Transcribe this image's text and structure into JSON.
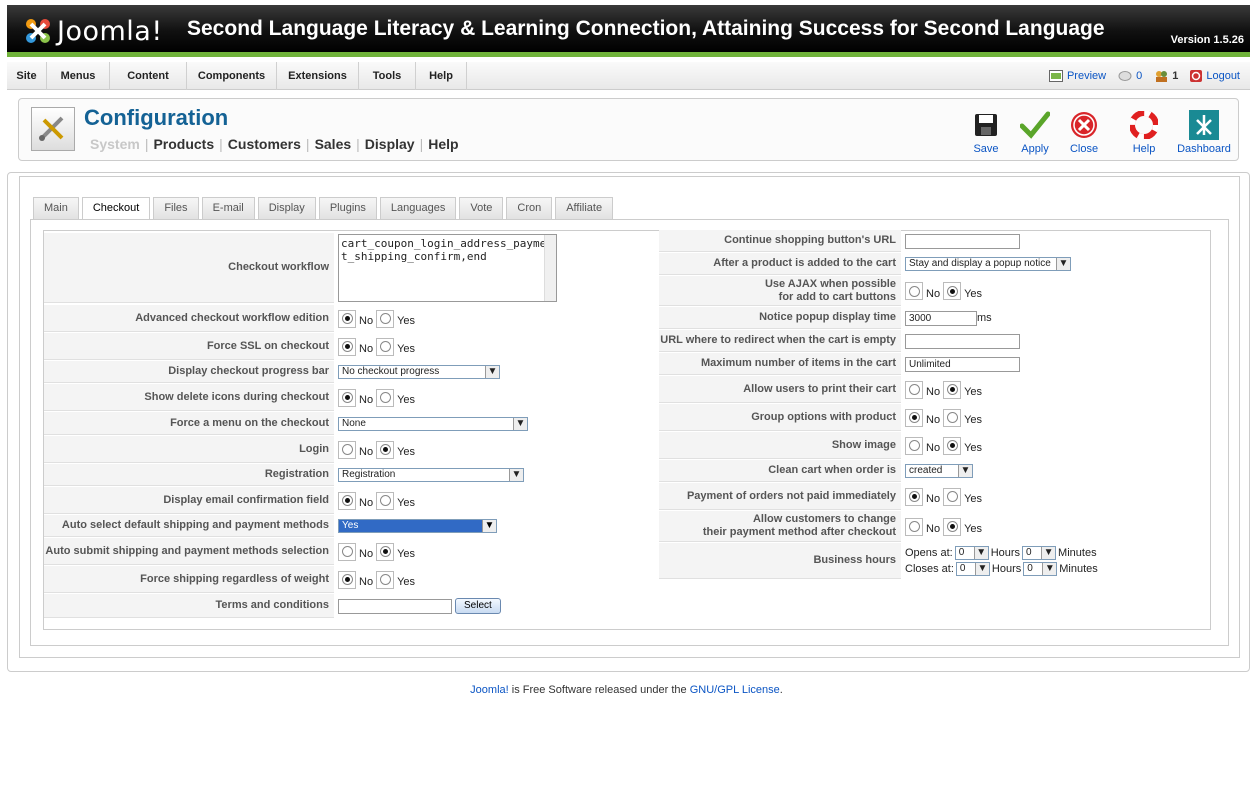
{
  "header": {
    "logo_text": "Joomla!",
    "site_title": "Second Language Literacy & Learning Connection, Attaining Success for Second Language",
    "version": "Version 1.5.26"
  },
  "menu": [
    "Site",
    "Menus",
    "Content",
    "Components",
    "Extensions",
    "Tools",
    "Help"
  ],
  "status": {
    "preview": "Preview",
    "messages_count": "0",
    "users_count": "1",
    "logout": "Logout"
  },
  "toolbar": {
    "title": "Configuration",
    "submenu": [
      "System",
      "Products",
      "Customers",
      "Sales",
      "Display",
      "Help"
    ],
    "buttons": [
      "Save",
      "Apply",
      "Close",
      "Help",
      "Dashboard"
    ]
  },
  "tabs": [
    "Main",
    "Checkout",
    "Files",
    "E-mail",
    "Display",
    "Plugins",
    "Languages",
    "Vote",
    "Cron",
    "Affiliate"
  ],
  "left": {
    "checkout_workflow": {
      "label": "Checkout workflow",
      "value": "cart_coupon_login_address_payment_shipping_confirm,end"
    },
    "advanced_workflow": {
      "label": "Advanced checkout workflow edition",
      "no": "No",
      "yes": "Yes"
    },
    "force_ssl": {
      "label": "Force SSL on checkout",
      "no": "No",
      "yes": "Yes"
    },
    "progress_bar": {
      "label": "Display checkout progress bar",
      "value": "No checkout progress"
    },
    "delete_icons": {
      "label": "Show delete icons during checkout",
      "no": "No",
      "yes": "Yes"
    },
    "force_menu": {
      "label": "Force a menu on the checkout",
      "value": "None"
    },
    "login": {
      "label": "Login",
      "no": "No",
      "yes": "Yes"
    },
    "registration": {
      "label": "Registration",
      "value": "Registration"
    },
    "email_confirm": {
      "label": "Display email confirmation field",
      "no": "No",
      "yes": "Yes"
    },
    "auto_select": {
      "label": "Auto select default shipping and payment methods",
      "value": "Yes"
    },
    "auto_submit": {
      "label": "Auto submit shipping and payment methods selection",
      "no": "No",
      "yes": "Yes"
    },
    "force_shipping": {
      "label": "Force shipping regardless of weight",
      "no": "No",
      "yes": "Yes"
    },
    "terms": {
      "label": "Terms and conditions",
      "button": "Select"
    }
  },
  "right": {
    "continue_url": {
      "label": "Continue shopping button's URL"
    },
    "after_added": {
      "label": "After a product is added to the cart",
      "value": "Stay and display a popup notice"
    },
    "ajax": {
      "label_1": "Use AJAX when possible",
      "label_2": "for add to cart buttons",
      "no": "No",
      "yes": "Yes"
    },
    "popup_time": {
      "label": "Notice popup display time",
      "value": "3000",
      "unit": "ms"
    },
    "redirect_empty": {
      "label": "URL where to redirect when the cart is empty"
    },
    "max_items": {
      "label": "Maximum number of items in the cart",
      "value": "Unlimited"
    },
    "print_cart": {
      "label": "Allow users to print their cart",
      "no": "No",
      "yes": "Yes"
    },
    "group_options": {
      "label": "Group options with product",
      "no": "No",
      "yes": "Yes"
    },
    "show_image": {
      "label": "Show image",
      "no": "No",
      "yes": "Yes"
    },
    "clean_cart": {
      "label": "Clean cart when order is",
      "value": "created"
    },
    "payment_not_paid": {
      "label": "Payment of orders not paid immediately",
      "no": "No",
      "yes": "Yes"
    },
    "change_payment": {
      "label_1": "Allow customers to change",
      "label_2": "their payment method after checkout",
      "no": "No",
      "yes": "Yes"
    },
    "business_hours": {
      "label": "Business hours",
      "opens": "Opens at:",
      "closes": "Closes at:",
      "hours": "Hours",
      "minutes": "Minutes",
      "open_h": "0",
      "open_m": "0",
      "close_h": "0",
      "close_m": "0"
    }
  },
  "footer": {
    "joomla": "Joomla!",
    "middle": " is Free Software released under the ",
    "license": "GNU/GPL License",
    "end": "."
  }
}
